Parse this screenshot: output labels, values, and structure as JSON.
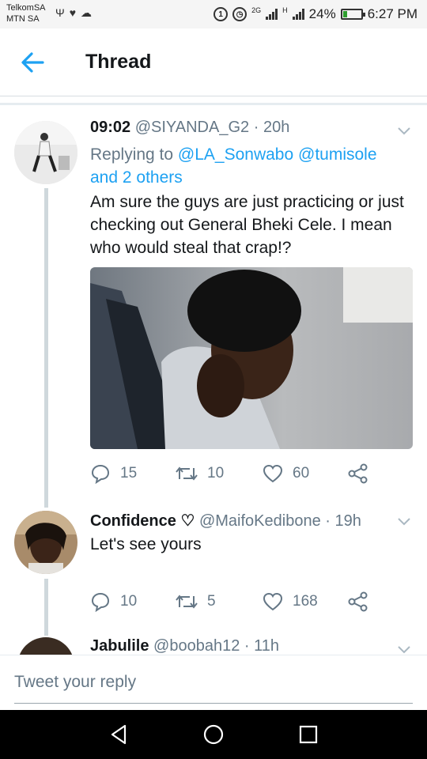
{
  "status_bar": {
    "carrier_1": "TelkomSA",
    "carrier_2": "MTN SA",
    "alarm_badge": "1",
    "network_2g": "2G",
    "network_h": "H",
    "battery_text": "24%",
    "battery_level": 0.24,
    "time": "6:27 PM"
  },
  "header": {
    "title": "Thread"
  },
  "tweets": [
    {
      "time_prefix": "09:02",
      "handle": "@SIYANDA_G2",
      "age": "20h",
      "reply_label": "Replying to",
      "reply_user_1": "@LA_Sonwabo",
      "reply_user_2": "@tumisole",
      "reply_others": "and 2 others",
      "text": "Am sure the guys are just practicing or just checking out General Bheki Cele. I mean who would steal that crap!?",
      "replies": "15",
      "retweets": "10",
      "likes": "60"
    },
    {
      "name": "Confidence",
      "name_emoji": "♡",
      "handle": "@MaifoKedibone",
      "age": "19h",
      "text": "Let's see yours",
      "replies": "10",
      "retweets": "5",
      "likes": "168"
    },
    {
      "name": "Jabulile",
      "handle": "@boobah12",
      "age": "11h"
    }
  ],
  "reply_bar": {
    "placeholder": "Tweet your reply"
  },
  "icons": {
    "back": "back-arrow-icon",
    "chevron": "chevron-down-icon",
    "reply": "reply-icon",
    "retweet": "retweet-icon",
    "like": "heart-icon",
    "share": "share-icon"
  },
  "colors": {
    "link": "#1da1f2",
    "muted": "#657786",
    "text": "#14171a"
  }
}
